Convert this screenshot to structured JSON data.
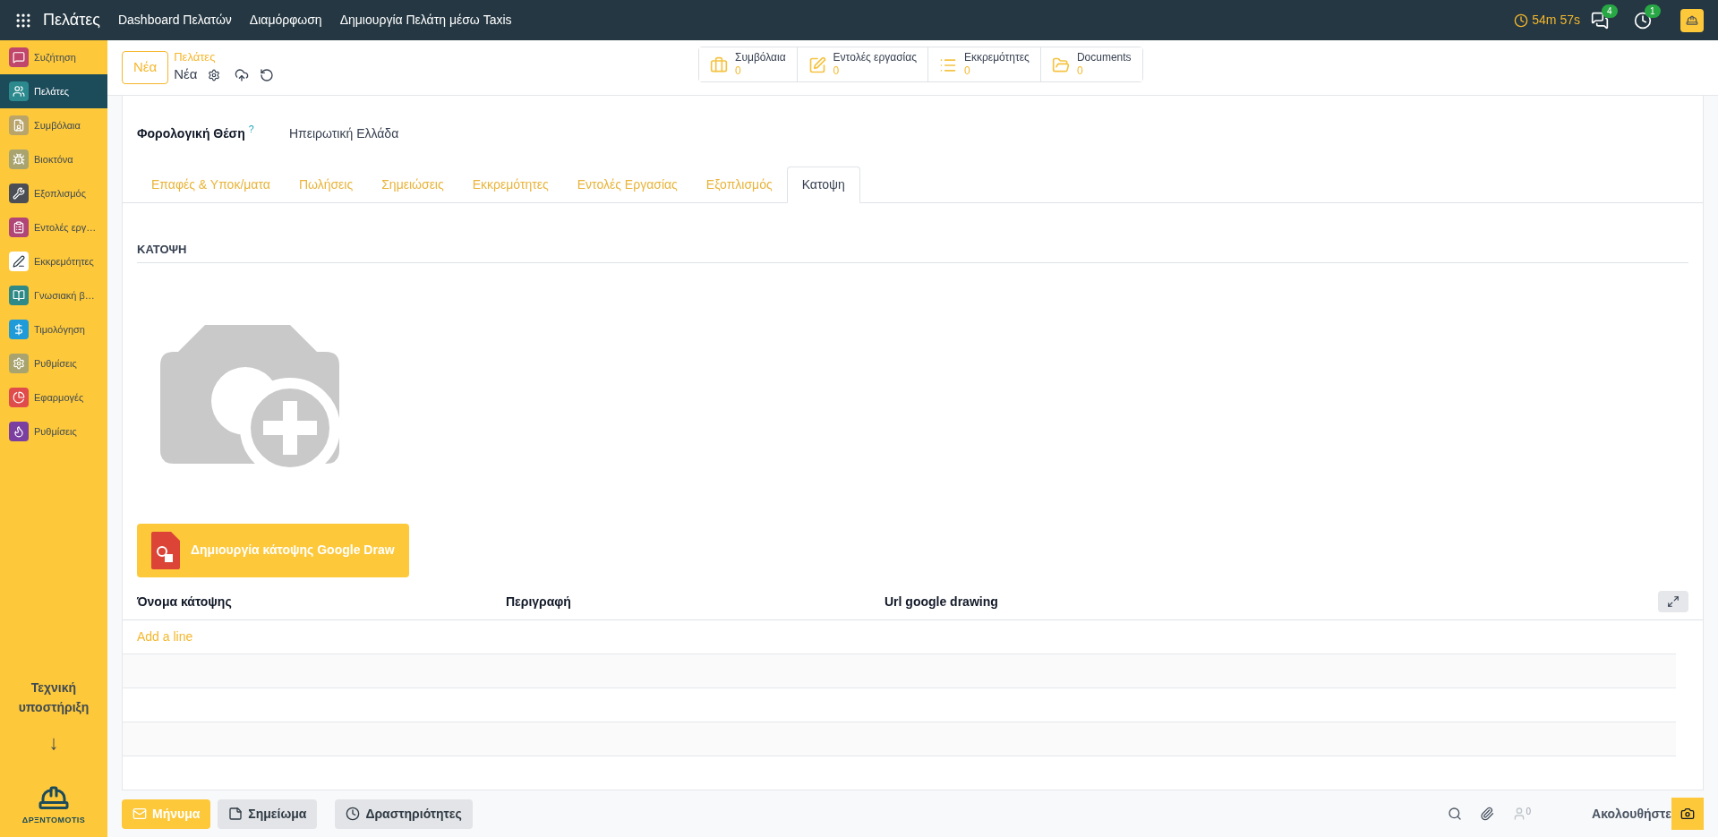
{
  "topbar": {
    "app_name": "Πελάτες",
    "menu": [
      "Dashboard Πελατών",
      "Διαμόρφωση",
      "Δημιουργία Πελάτη μέσω Taxis"
    ],
    "timer": "54m 57s",
    "chat_count": "4",
    "activity_count": "1"
  },
  "sidebar": {
    "items": [
      {
        "label": "Συζήτηση",
        "selected": false
      },
      {
        "label": "Πελάτες",
        "selected": true
      },
      {
        "label": "Συμβόλαια",
        "selected": false
      },
      {
        "label": "Βιοκτόνα",
        "selected": false
      },
      {
        "label": "Εξοπλισμός",
        "selected": false
      },
      {
        "label": "Εντολές εργ…",
        "selected": false
      },
      {
        "label": "Εκκρεμότητες",
        "selected": false
      },
      {
        "label": "Γνωσιακή β…",
        "selected": false
      },
      {
        "label": "Τιμολόγηση",
        "selected": false
      },
      {
        "label": "Ρυθμίσεις",
        "selected": false
      },
      {
        "label": "Εφαρμογές",
        "selected": false
      },
      {
        "label": "Ρυθμίσεις",
        "selected": false
      }
    ],
    "support": "Τεχνική υποστήριξη",
    "support_arrow": "↓",
    "logo_text": "ΔΡΞΝΤΟΜOTIS"
  },
  "control_panel": {
    "new_button": "Νέα",
    "breadcrumb": "Πελάτες",
    "record": "Νέα",
    "smart_buttons": [
      {
        "label": "Συμβόλαια",
        "count": "0"
      },
      {
        "label": "Εντολές εργασίας",
        "count": "0"
      },
      {
        "label": "Εκκρεμότητες",
        "count": "0"
      },
      {
        "label": "Documents",
        "count": "0"
      }
    ]
  },
  "form": {
    "field_label": "Φορολογική Θέση",
    "field_help": "?",
    "field_value": "Ηπειρωτική Ελλάδα",
    "tabs": [
      {
        "label": "Επαφές & Υποκ/ματα",
        "selected": false
      },
      {
        "label": "Πωλήσεις",
        "selected": false
      },
      {
        "label": "Σημειώσεις",
        "selected": false
      },
      {
        "label": "Εκκρεμότητες",
        "selected": false
      },
      {
        "label": "Εντολές Εργασίας",
        "selected": false
      },
      {
        "label": "Εξοπλισμός",
        "selected": false
      },
      {
        "label": "Κατοψη",
        "selected": true
      }
    ],
    "section_title": "ΚΑΤΟΨΗ",
    "draw_button": "Δημιουργία κάτοψης Google Draw",
    "table": {
      "columns": [
        "Όνομα κάτοψης",
        "Περιγραφή",
        "Url google drawing"
      ],
      "add_line": "Add a line"
    }
  },
  "chatter": {
    "buttons": [
      {
        "label": "Μήνυμα",
        "kind": "primary"
      },
      {
        "label": "Σημείωμα",
        "kind": "secondary"
      },
      {
        "label": "Δραστηριότητες",
        "kind": "secondary"
      }
    ],
    "followers_count": "0",
    "follow": "Ακολουθήστε"
  }
}
